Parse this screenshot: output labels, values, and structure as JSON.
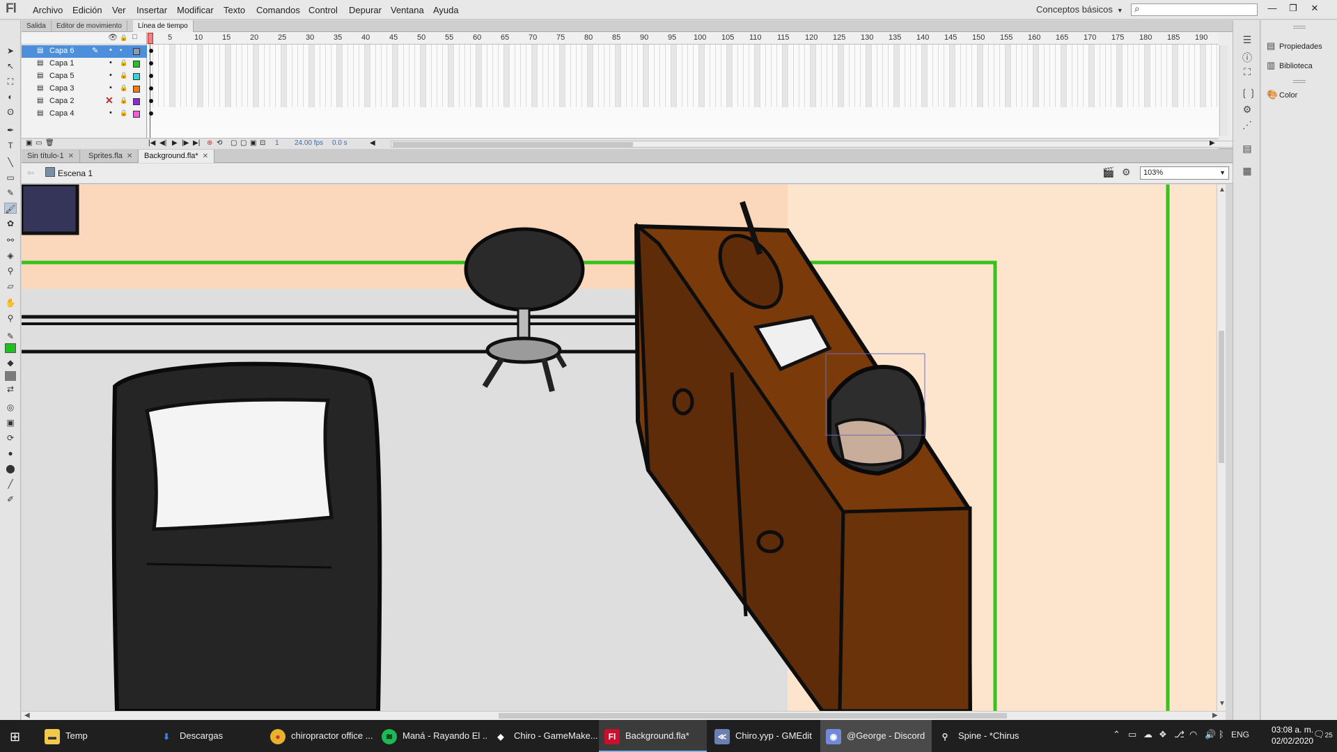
{
  "menubar": {
    "logo": "Fl",
    "items": [
      "Archivo",
      "Edición",
      "Ver",
      "Insertar",
      "Modificar",
      "Texto",
      "Comandos",
      "Control",
      "Depurar",
      "Ventana",
      "Ayuda"
    ],
    "workspace": "Conceptos básicos",
    "search_placeholder": ""
  },
  "timeline": {
    "tabs": [
      "Salida",
      "Editor de movimiento",
      "Línea de tiempo"
    ],
    "active_tab": "Línea de tiempo",
    "layers": [
      {
        "name": "Capa 6",
        "color": "#5a88b8",
        "selected": true
      },
      {
        "name": "Capa 1",
        "color": "#22c322"
      },
      {
        "name": "Capa 5",
        "color": "#31d6d6"
      },
      {
        "name": "Capa 3",
        "color": "#f07f12"
      },
      {
        "name": "Capa 2",
        "color": "#8a2bd6",
        "hidden": true
      },
      {
        "name": "Capa 4",
        "color": "#f05be0"
      }
    ],
    "ruler_ticks": [
      "1",
      "5",
      "10",
      "15",
      "20",
      "25",
      "30",
      "35",
      "40",
      "45",
      "50",
      "55",
      "60",
      "65",
      "70",
      "75",
      "80",
      "85",
      "90",
      "95",
      "100",
      "105",
      "110",
      "115",
      "120",
      "125",
      "130",
      "135",
      "140",
      "145",
      "150",
      "155",
      "160",
      "165",
      "170",
      "175",
      "180",
      "185",
      "190"
    ],
    "current_frame": "1",
    "fps": "24.00 fps",
    "time": "0.0 s"
  },
  "document_tabs": [
    {
      "label": "Sin título-1",
      "active": false
    },
    {
      "label": "Sprites.fla",
      "active": false
    },
    {
      "label": "Background.fla*",
      "active": true
    }
  ],
  "scene": {
    "name": "Escena 1",
    "zoom": "103%"
  },
  "right_panels": [
    "Propiedades",
    "Biblioteca",
    "Color"
  ],
  "taskbar": {
    "items": [
      {
        "label": "Temp",
        "icon": "folder-icon",
        "color": "#f2c94c"
      },
      {
        "label": "Descargas",
        "icon": "download-icon",
        "color": "#3a86e0"
      },
      {
        "label": "chiropractor office ...",
        "icon": "chrome-icon",
        "color": "#e8b32a"
      },
      {
        "label": "Maná - Rayando El ...",
        "icon": "spotify-icon",
        "color": "#1db954"
      },
      {
        "label": "Chiro - GameMake...",
        "icon": "gamemaker-icon",
        "color": "#ffffff"
      },
      {
        "label": "Background.fla*",
        "icon": "flash-icon",
        "color": "#c8102e",
        "active": true
      },
      {
        "label": "Chiro.yyp - GMEdit",
        "icon": "gmedit-icon",
        "color": "#6b7fb0"
      },
      {
        "label": "@George - Discord",
        "icon": "discord-icon",
        "color": "#7289da",
        "highlight": true
      },
      {
        "label": "Spine - *Chirus",
        "icon": "spine-icon",
        "color": "#dddddd"
      }
    ],
    "language": "ENG",
    "time": "03:08 a. m.",
    "date": "02/02/2020",
    "notifications": "25"
  }
}
